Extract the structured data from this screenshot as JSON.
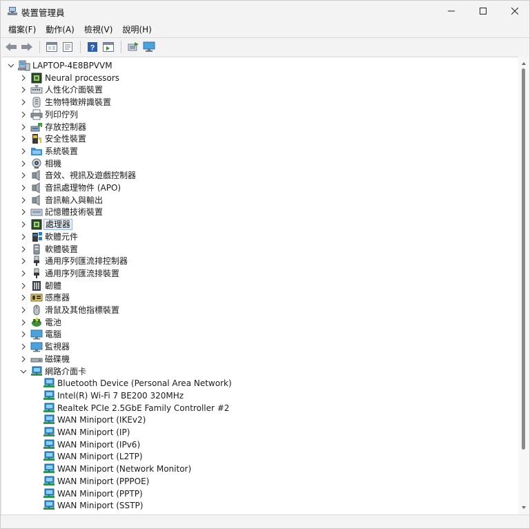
{
  "window": {
    "title": "裝置管理員",
    "minimize_icon": "minimize-icon",
    "maximize_icon": "maximize-icon",
    "close_icon": "close-icon"
  },
  "menu": [
    {
      "label": "檔案(F)"
    },
    {
      "label": "動作(A)"
    },
    {
      "label": "檢視(V)"
    },
    {
      "label": "說明(H)"
    }
  ],
  "toolbar": [
    "back-arrow-icon",
    "forward-arrow-icon",
    "properties-icon",
    "update-driver-icon",
    "help-icon",
    "view-icon",
    "scan-hardware-icon",
    "monitor-icon"
  ],
  "tree": {
    "root": "LAPTOP-4E8BPVVM",
    "categories": [
      {
        "label": "Neural processors",
        "icon": "chip-icon"
      },
      {
        "label": "人性化介面裝置",
        "icon": "hid-icon"
      },
      {
        "label": "生物特徵辨識裝置",
        "icon": "fingerprint-icon"
      },
      {
        "label": "列印佇列",
        "icon": "printer-icon"
      },
      {
        "label": "存放控制器",
        "icon": "storage-controller-icon"
      },
      {
        "label": "安全性裝置",
        "icon": "security-key-icon"
      },
      {
        "label": "系統裝置",
        "icon": "system-folder-icon"
      },
      {
        "label": "相機",
        "icon": "camera-icon"
      },
      {
        "label": "音效、視訊及遊戲控制器",
        "icon": "speaker-icon"
      },
      {
        "label": "音訊處理物件 (APO)",
        "icon": "speaker-icon"
      },
      {
        "label": "音訊輸入與輸出",
        "icon": "speaker-icon"
      },
      {
        "label": "記憶體技術裝置",
        "icon": "memory-card-icon"
      },
      {
        "label": "處理器",
        "icon": "processor-icon",
        "selected": true
      },
      {
        "label": "軟體元件",
        "icon": "software-component-icon"
      },
      {
        "label": "軟體裝置",
        "icon": "software-device-icon"
      },
      {
        "label": "通用序列匯流排控制器",
        "icon": "usb-icon"
      },
      {
        "label": "通用序列匯流排裝置",
        "icon": "usb-icon"
      },
      {
        "label": "韌體",
        "icon": "firmware-icon"
      },
      {
        "label": "感應器",
        "icon": "sensor-icon"
      },
      {
        "label": "滑鼠及其他指標裝置",
        "icon": "mouse-icon"
      },
      {
        "label": "電池",
        "icon": "battery-icon"
      },
      {
        "label": "電腦",
        "icon": "computer-icon"
      },
      {
        "label": "監視器",
        "icon": "monitor-icon"
      },
      {
        "label": "磁碟機",
        "icon": "disk-drive-icon"
      },
      {
        "label": "網路介面卡",
        "icon": "network-adapter-icon",
        "expanded": true
      }
    ],
    "network_children": [
      "Bluetooth Device (Personal Area Network)",
      "Intel(R) Wi-Fi 7 BE200 320MHz",
      "Realtek PCIe 2.5GbE Family Controller #2",
      "WAN Miniport (IKEv2)",
      "WAN Miniport (IP)",
      "WAN Miniport (IPv6)",
      "WAN Miniport (L2TP)",
      "WAN Miniport (Network Monitor)",
      "WAN Miniport (PPPOE)",
      "WAN Miniport (PPTP)",
      "WAN Miniport (SSTP)"
    ]
  },
  "colors": {
    "selection_border": "#8fb8e6",
    "selection_fill": "#e8f1fb",
    "network_icon": "#2f8fd6"
  }
}
